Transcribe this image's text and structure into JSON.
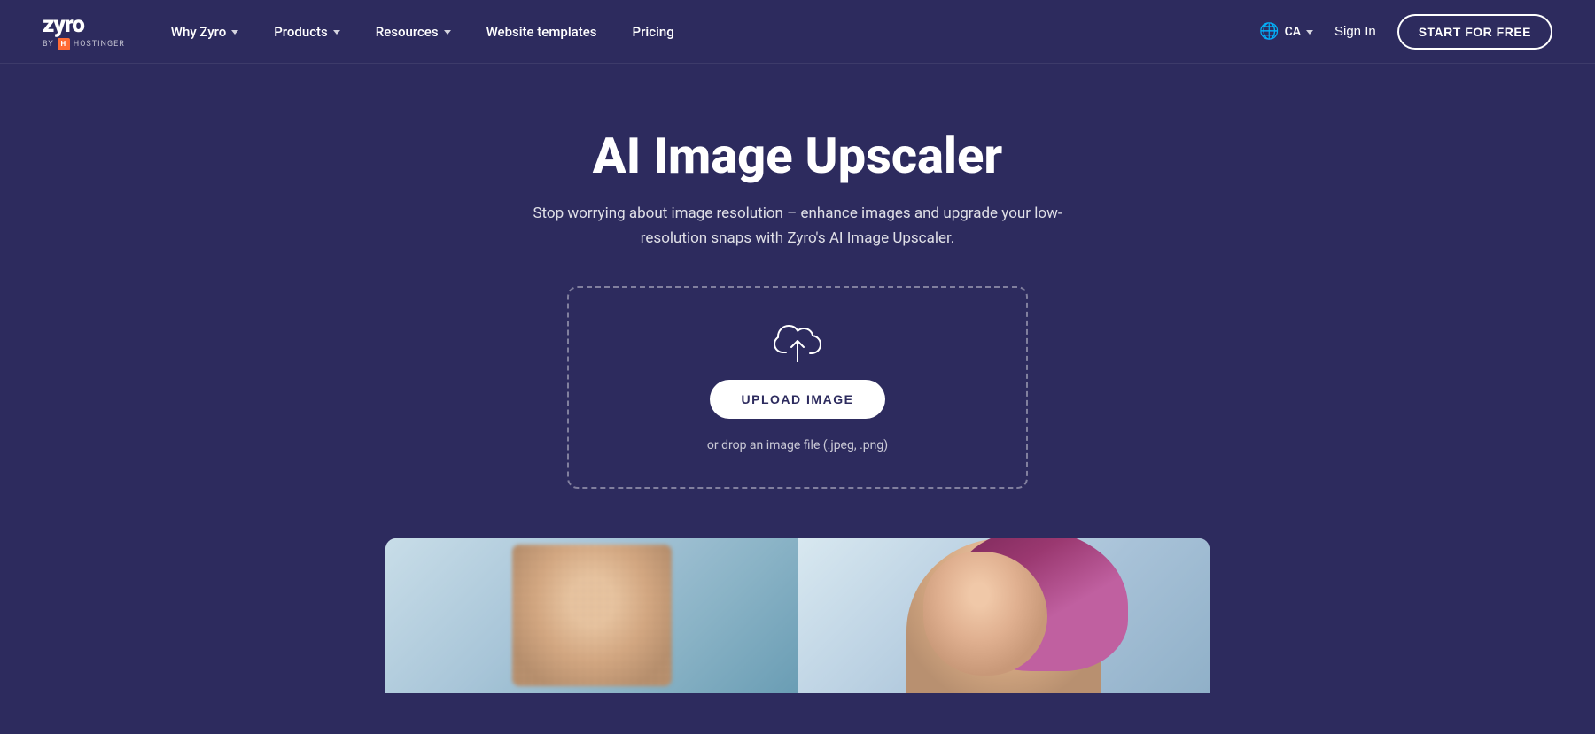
{
  "brand": {
    "name": "zyro",
    "by_label": "BY",
    "hostinger_label": "H",
    "partner_label": "HOSTINGER"
  },
  "nav": {
    "items": [
      {
        "id": "why-zyro",
        "label": "Why Zyro",
        "has_dropdown": true
      },
      {
        "id": "products",
        "label": "Products",
        "has_dropdown": true
      },
      {
        "id": "resources",
        "label": "Resources",
        "has_dropdown": true
      },
      {
        "id": "website-templates",
        "label": "Website templates",
        "has_dropdown": false
      },
      {
        "id": "pricing",
        "label": "Pricing",
        "has_dropdown": false
      }
    ],
    "locale": {
      "icon": "🌐",
      "label": "CA",
      "has_dropdown": true
    },
    "sign_in_label": "Sign In",
    "start_free_label": "START FOR FREE"
  },
  "hero": {
    "title": "AI Image Upscaler",
    "subtitle": "Stop worrying about image resolution – enhance images and upgrade your low-resolution snaps with Zyro's AI Image Upscaler."
  },
  "upload": {
    "button_label": "UPLOAD IMAGE",
    "hint": "or drop an image file (.jpeg,\n.png)"
  },
  "colors": {
    "background": "#2d2b5e",
    "nav_bg": "#2d2b5e",
    "accent": "#ffffff"
  }
}
